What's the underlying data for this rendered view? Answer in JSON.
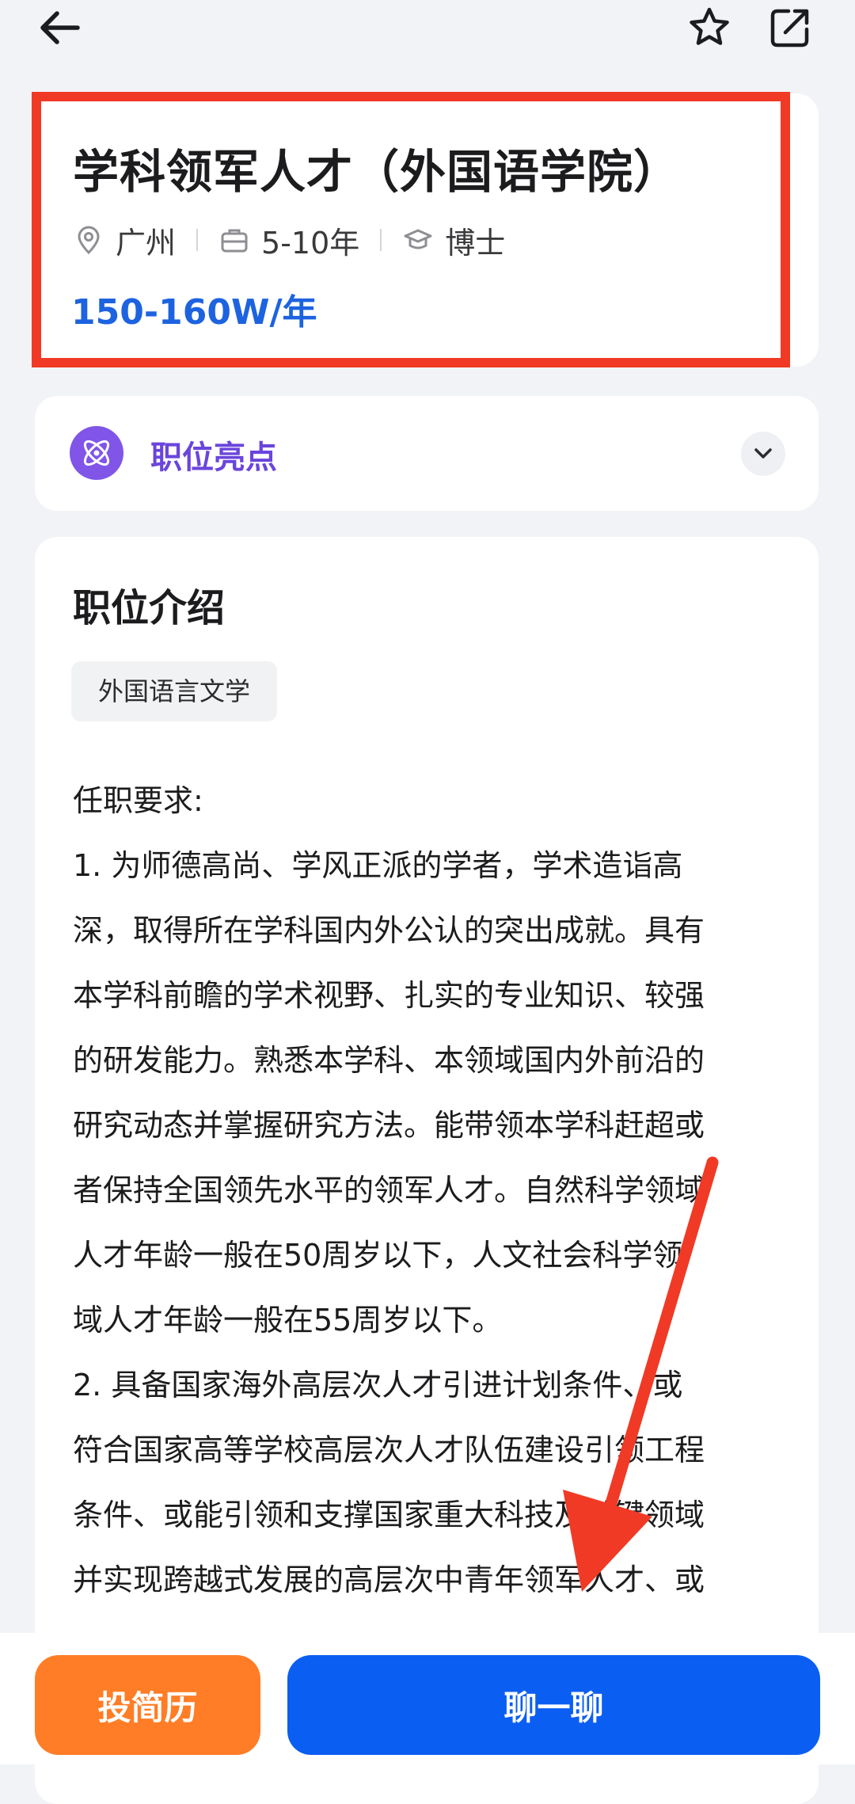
{
  "nav": {
    "back_icon": "back-arrow-icon",
    "favorite_icon": "star-icon",
    "share_icon": "share-icon"
  },
  "job": {
    "title": "学科领军人才（外国语学院）",
    "location": "广州",
    "experience": "5-10年",
    "education": "博士",
    "salary": "150-160W/年"
  },
  "highlights": {
    "label": "职位亮点",
    "icon": "atom-icon",
    "expand_icon": "chevron-down-icon"
  },
  "description": {
    "title": "职位介绍",
    "tag": "外国语言文学",
    "lines": [
      "任职要求:",
      "1. 为师德高尚、学风正派的学者，学术造诣高",
      "深，取得所在学科国内外公认的突出成就。具有",
      "本学科前瞻的学术视野、扎实的专业知识、较强",
      "的研发能力。熟悉本学科、本领域国内外前沿的",
      "研究动态并掌握研究方法。能带领本学科赶超或",
      "者保持全国领先水平的领军人才。自然科学领域",
      "人才年龄一般在50周岁以下，人文社会科学领",
      "域人才年龄一般在55周岁以下。",
      "2. 具备国家海外高层次人才引进计划条件、或",
      "符合国家高等学校高层次人才队伍建设引领工程",
      "条件、或能引领和支撑国家重大科技及关键领域",
      "并实现跨越式发展的高层次中青年领军人才、或"
    ]
  },
  "actions": {
    "resume": "投简历",
    "chat": "聊一聊"
  },
  "colors": {
    "accent_blue": "#0b5ef2",
    "salary_blue": "#1d63e0",
    "orange": "#ff7d26",
    "purple": "#8055e8",
    "annotation_red": "#f03a25"
  }
}
